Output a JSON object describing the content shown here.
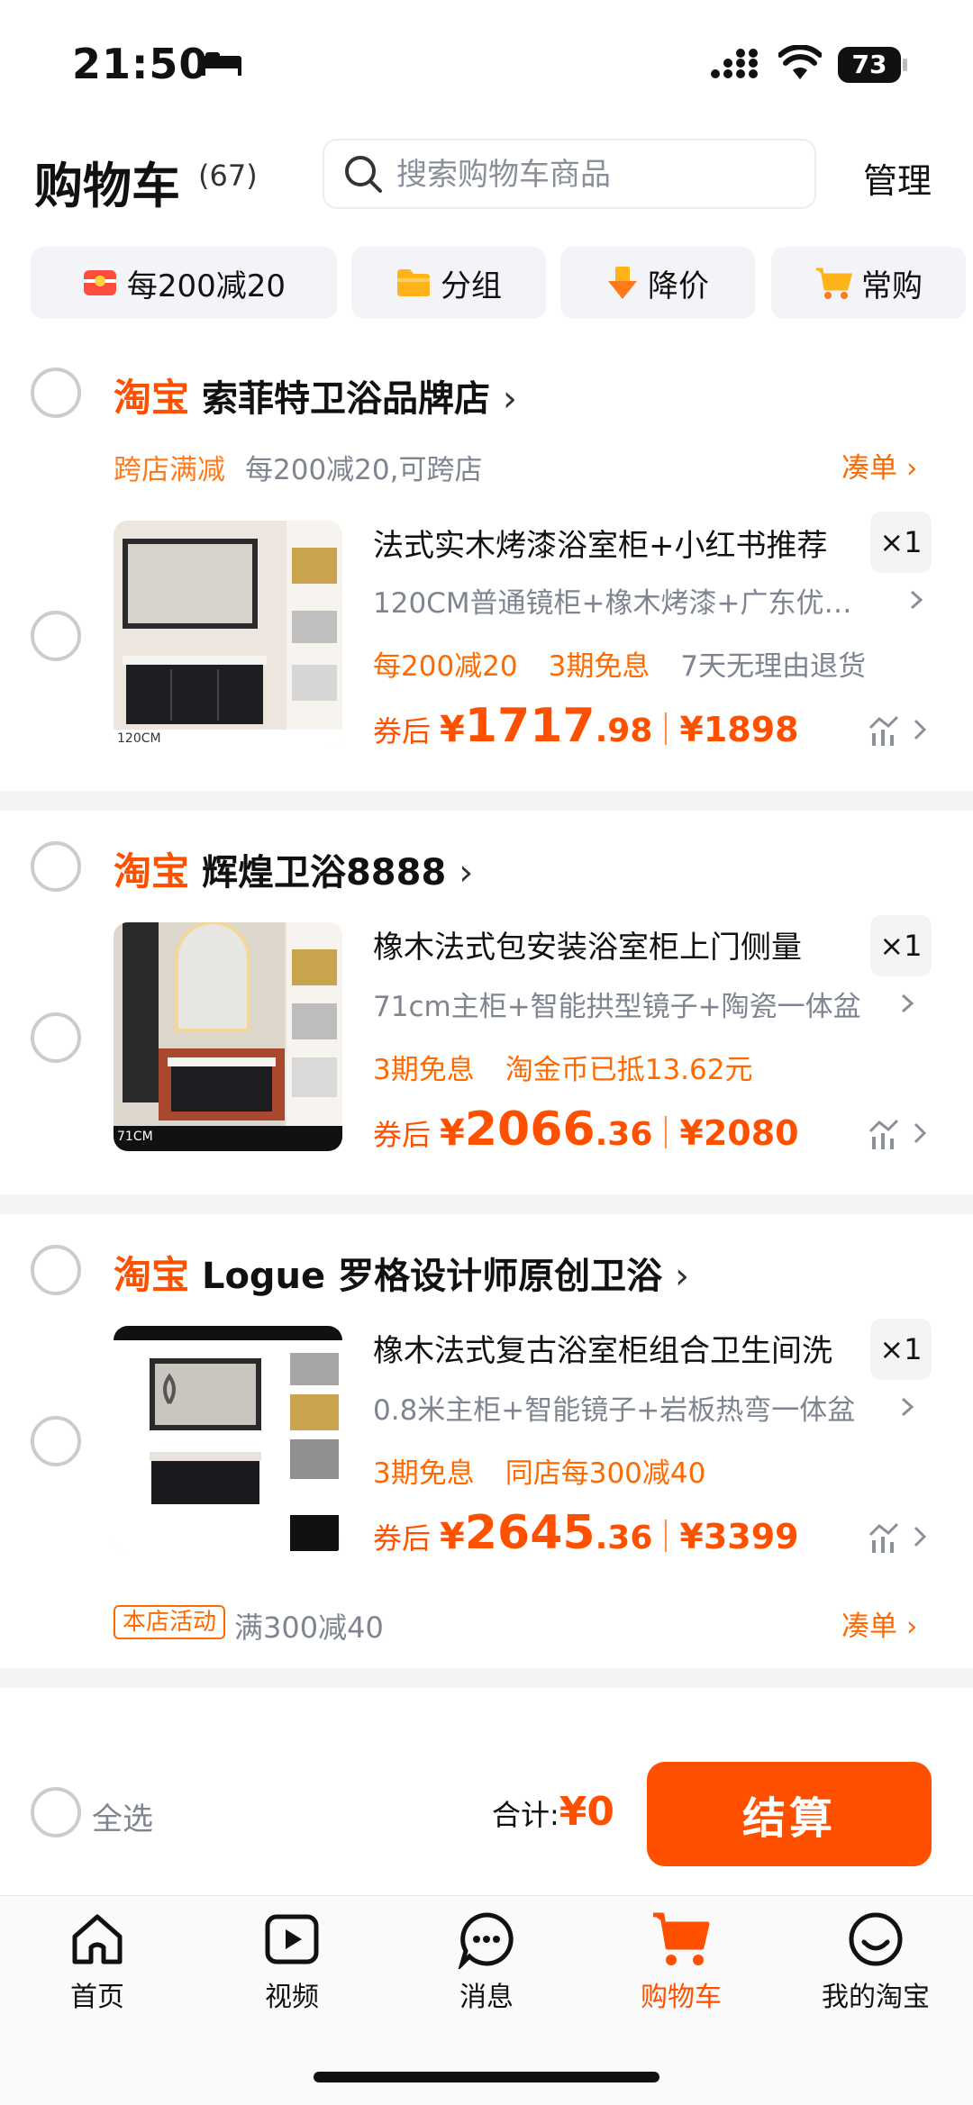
{
  "status": {
    "time": "21:50",
    "battery": "73"
  },
  "header": {
    "title": "购物车",
    "count": "(67)",
    "search_placeholder": "搜索购物车商品",
    "manage": "管理"
  },
  "chips": [
    {
      "label": "每200减20",
      "icon": "coupon-icon"
    },
    {
      "label": "分组",
      "icon": "folder-icon"
    },
    {
      "label": "降价",
      "icon": "price-drop-icon"
    },
    {
      "label": "常购",
      "icon": "cart-icon"
    }
  ],
  "stores": [
    {
      "platform": "淘宝",
      "name": "索菲特卫浴品牌店",
      "promo_label": "跨店满减",
      "promo_text": "每200减20,可跨店",
      "coudan": "凑单",
      "item": {
        "title": "法式实木烤漆浴室柜+小红书推荐",
        "qty": "×1",
        "sku": "120CM普通镜柜+橡木烤漆+广东优…",
        "tags": [
          "每200减20",
          "3期免息",
          "7天无理由退货"
        ],
        "price_label": "券后",
        "currency": "¥",
        "price_int": "1717",
        "price_dec": ".98",
        "orig_price": "¥1898",
        "thumb_badge": "120CM"
      }
    },
    {
      "platform": "淘宝",
      "name": "辉煌卫浴8888",
      "item": {
        "title": "橡木法式包安装浴室柜上门侧量",
        "qty": "×1",
        "sku": "71cm主柜+智能拱型镜子+陶瓷一体盆",
        "tags": [
          "3期免息",
          "淘金币已抵13.62元"
        ],
        "price_label": "券后",
        "currency": "¥",
        "price_int": "2066",
        "price_dec": ".36",
        "orig_price": "¥2080",
        "thumb_badge": "71CM"
      }
    },
    {
      "platform": "淘宝",
      "name": "Logue 罗格设计师原创卫浴",
      "item": {
        "title": "橡木法式复古浴室柜组合卫生间洗",
        "qty": "×1",
        "sku": "0.8米主柜+智能镜子+岩板热弯一体盆",
        "tags": [
          "3期免息",
          "同店每300减40"
        ],
        "price_label": "券后",
        "currency": "¥",
        "price_int": "2645",
        "price_dec": ".36",
        "orig_price": "¥3399",
        "thumb_badge": ""
      },
      "activity_label": "本店活动",
      "activity_text": "满300减40",
      "coudan": "凑单"
    }
  ],
  "footer": {
    "select_all": "全选",
    "total_label": "合计:",
    "total_value": "¥0",
    "checkout": "结算"
  },
  "tabs": [
    {
      "label": "首页",
      "icon": "home-icon"
    },
    {
      "label": "视频",
      "icon": "video-icon"
    },
    {
      "label": "消息",
      "icon": "message-icon"
    },
    {
      "label": "购物车",
      "icon": "cart-icon",
      "active": true
    },
    {
      "label": "我的淘宝",
      "icon": "profile-icon"
    }
  ],
  "colors": {
    "accent": "#ff5000",
    "gray_text": "#7f8590",
    "separator": "#f3f4f6"
  }
}
